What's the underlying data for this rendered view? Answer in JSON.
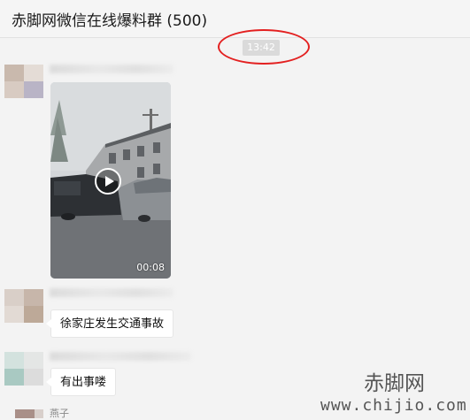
{
  "window": {
    "title": "赤脚网微信在线爆料群 (500)"
  },
  "chat": {
    "timestamp": "13:42",
    "messages": [
      {
        "type": "video",
        "duration": "00:08"
      },
      {
        "type": "text",
        "text": "徐家庄发生交通事故"
      },
      {
        "type": "text",
        "text": "有出事喽"
      }
    ],
    "last_sender_name": "燕子"
  },
  "watermark": {
    "name": "赤脚网",
    "url": "www.chijio.com"
  },
  "colors": {
    "highlight": "#e32020",
    "timestamp_bg": "#dadada",
    "background": "#f3f3f3"
  },
  "icons": {
    "play": "play-icon"
  }
}
